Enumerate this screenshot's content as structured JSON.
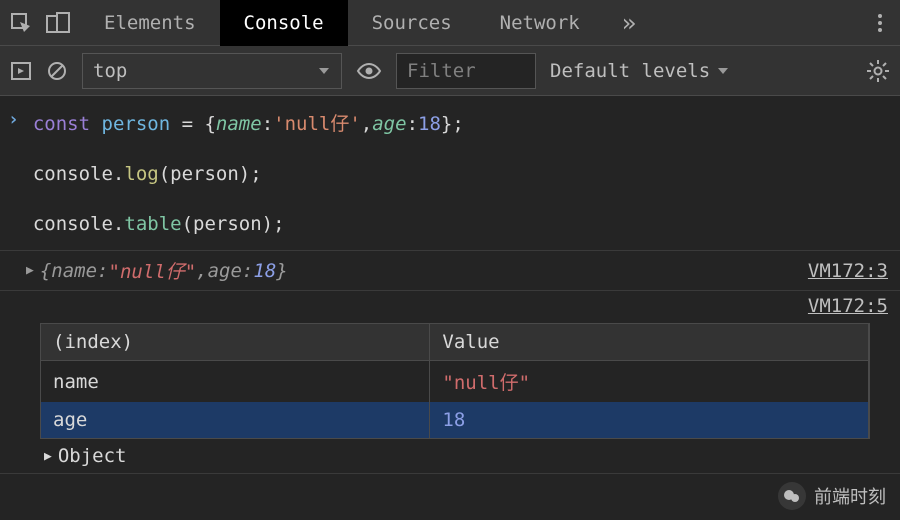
{
  "tabs": {
    "elements": "Elements",
    "console": "Console",
    "sources": "Sources",
    "network": "Network",
    "more": "»"
  },
  "toolbar": {
    "context": "top",
    "filter_placeholder": "Filter",
    "levels": "Default levels"
  },
  "code": {
    "const": "const",
    "varname": "person",
    "eq": " = ",
    "lbrace": "{",
    "prop_name": "name",
    "colon": ":",
    "str_val": "'null仔'",
    "comma": ",",
    "prop_age": "age",
    "num_val": "18",
    "rbrace": "};",
    "line2_obj": "console",
    "line2_dot": ".",
    "line2_log": "log",
    "line2_args": "(person);",
    "line3_obj": "console",
    "line3_dot": ".",
    "line3_table": "table",
    "line3_args": "(person);"
  },
  "output_log": {
    "open": "{",
    "p1": "name",
    "c1": ": ",
    "v1": "\"null仔\"",
    "sep": ", ",
    "p2": "age",
    "c2": ": ",
    "v2": "18",
    "close": "}",
    "source": "VM172:3"
  },
  "output_table": {
    "source": "VM172:5",
    "headers": {
      "index": "(index)",
      "value": "Value"
    },
    "rows": [
      {
        "k": "name",
        "v": "\"null仔\"",
        "type": "str"
      },
      {
        "k": "age",
        "v": "18",
        "type": "num"
      }
    ],
    "object_label": "Object"
  },
  "watermark": "前端时刻"
}
